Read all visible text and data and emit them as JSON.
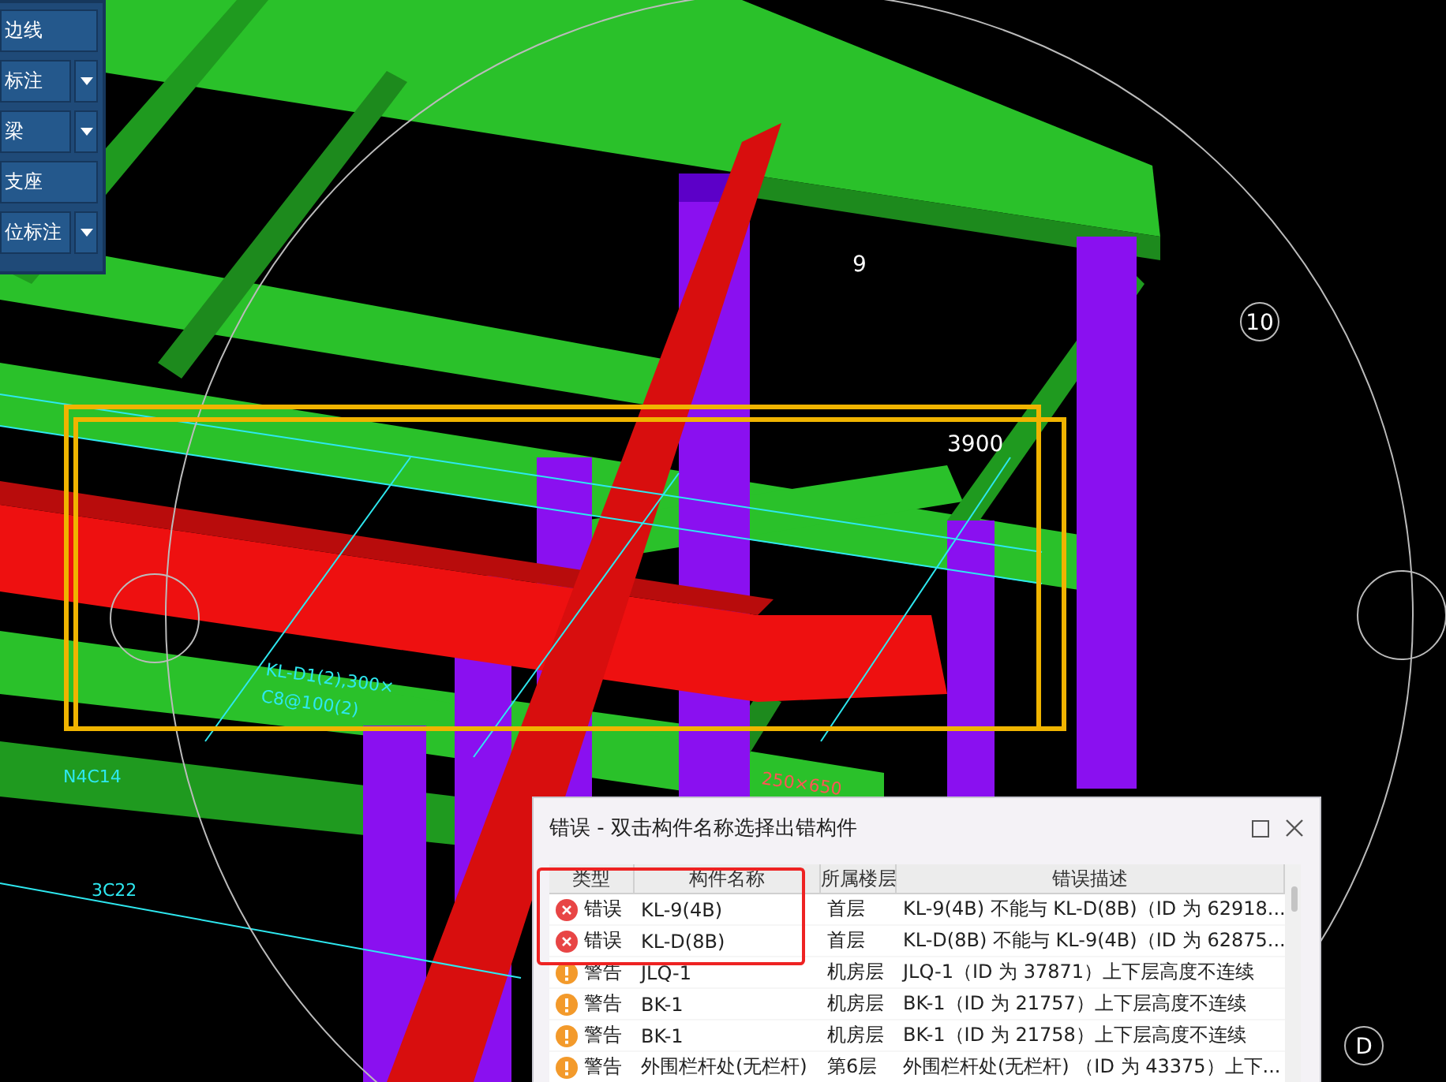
{
  "toolbar": {
    "buttons": [
      {
        "label": "边线",
        "dropdown": false
      },
      {
        "label": "标注",
        "dropdown": true
      },
      {
        "label": "梁",
        "dropdown": true
      },
      {
        "label": "支座",
        "dropdown": false
      },
      {
        "label": "位标注",
        "dropdown": true
      }
    ]
  },
  "scene": {
    "axis_labels": [
      {
        "label": "10"
      },
      {
        "label": "D"
      },
      {
        "label": "9"
      }
    ],
    "dimension": "3900",
    "annotations": [
      "KL-D1(2),300×",
      "C8@100(2)",
      "250×650",
      "N4C14",
      "3C22"
    ]
  },
  "dialog": {
    "title": "错误 - 双击构件名称选择出错构件",
    "columns": [
      "类型",
      "构件名称",
      "所属楼层",
      "错误描述"
    ],
    "rows": [
      {
        "kind": "error",
        "type": "错误",
        "name": "KL-9(4B)",
        "floor": "首层",
        "description": "KL-9(4B) 不能与 KL-D(8B)（ID 为 62918...",
        "highlighted": true
      },
      {
        "kind": "error",
        "type": "错误",
        "name": "KL-D(8B)",
        "floor": "首层",
        "description": "KL-D(8B) 不能与 KL-9(4B)（ID 为 62875...",
        "highlighted": true
      },
      {
        "kind": "warning",
        "type": "警告",
        "name": "JLQ-1",
        "floor": "机房层",
        "description": "JLQ-1（ID 为 37871）上下层高度不连续",
        "highlighted": false
      },
      {
        "kind": "warning",
        "type": "警告",
        "name": "BK-1",
        "floor": "机房层",
        "description": "BK-1（ID 为 21757）上下层高度不连续",
        "highlighted": false
      },
      {
        "kind": "warning",
        "type": "警告",
        "name": "BK-1",
        "floor": "机房层",
        "description": "BK-1（ID 为 21758）上下层高度不连续",
        "highlighted": false
      },
      {
        "kind": "warning",
        "type": "警告",
        "name": "外围栏杆处(无栏杆)",
        "floor": "第6层",
        "description": "外围栏杆处(无栏杆)  （ID 为 43375）上下...",
        "highlighted": false
      }
    ]
  }
}
